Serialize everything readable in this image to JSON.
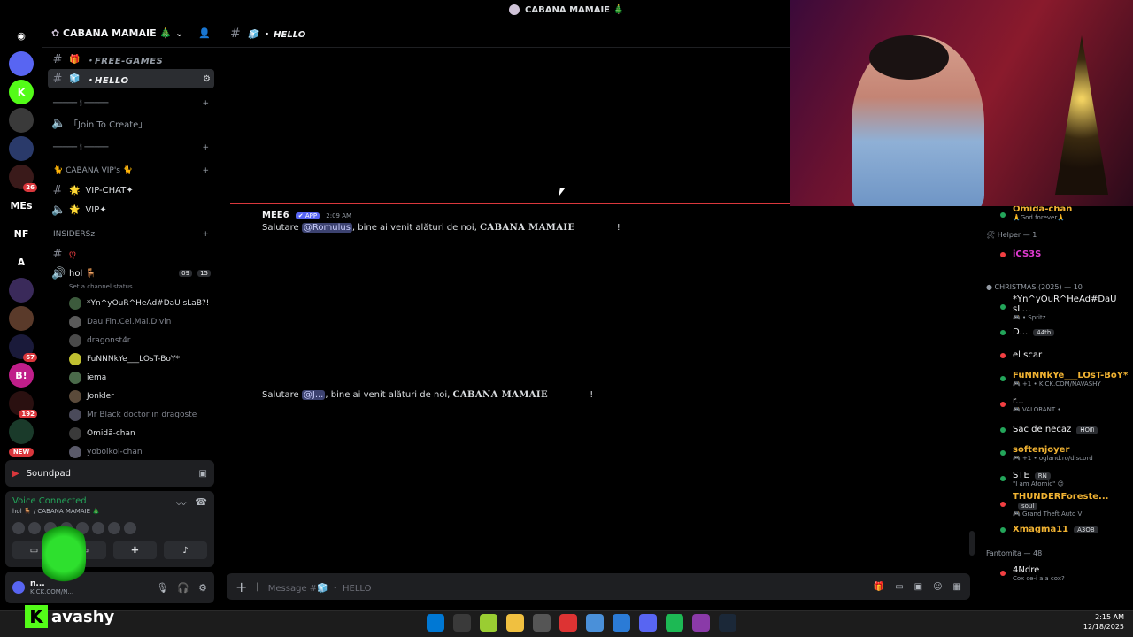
{
  "window": {
    "title": "CABANA MAMAIE 🎄"
  },
  "rail": {
    "servers": [
      {
        "label": "",
        "badge": "",
        "color": "#5865f2"
      },
      {
        "label": "K",
        "badge": "",
        "color": "#53fc18"
      },
      {
        "label": "",
        "badge": "",
        "color": "#3a3a3a"
      },
      {
        "label": "",
        "badge": "",
        "color": "#2a3a6a"
      },
      {
        "label": "",
        "badge": "26",
        "color": "#3a1a1a"
      },
      {
        "label": "MEs",
        "badge": "",
        "color": "#000000"
      },
      {
        "label": "NF",
        "badge": "",
        "color": "#000000"
      },
      {
        "label": "A",
        "badge": "",
        "color": "#000000"
      },
      {
        "label": "",
        "badge": "",
        "color": "#3a2a5a"
      },
      {
        "label": "",
        "badge": "",
        "color": "#5a3a2a"
      },
      {
        "label": "",
        "badge": "67",
        "color": "#1a1a3a"
      },
      {
        "label": "B!",
        "badge": "",
        "color": "#c01e8a"
      },
      {
        "label": "",
        "badge": "192",
        "color": "#2a1010"
      },
      {
        "label": "",
        "badge": "",
        "color": "#1a3a2a"
      }
    ],
    "new_label": "NEW"
  },
  "sidebar": {
    "server_name": "CABANA MAMAIE 🎄",
    "channels": [
      {
        "type": "text",
        "prefix": "🎁",
        "name": "・FREE-GAMES",
        "selected": false,
        "italic": true
      },
      {
        "type": "text",
        "prefix": "🧊",
        "name": "・HELLO",
        "selected": true,
        "italic": true
      }
    ],
    "divider1": "───── 🕯 ─────",
    "join_channel": "「Join To Create」",
    "divider2": "───── 🕯 ─────",
    "vip_category": "🐈 CABANA VIP's 🐈",
    "vip_channels": [
      {
        "type": "text",
        "prefix": "🌟",
        "name": "VIP-CHAT✦"
      },
      {
        "type": "voice",
        "prefix": "🌟",
        "name": "VIP✦"
      }
    ],
    "insiders_category": "INSIDERSz",
    "insiders_text_channel": "ღ",
    "voice_channel": {
      "name": "hol 🪑",
      "status_hint": "Set a channel status",
      "count_a": "09",
      "count_b": "15"
    },
    "voice_users": [
      {
        "name": "*Yn^yOuR^HeAd#DaU sLaB?!",
        "dim": false
      },
      {
        "name": "Dau.Fin.Cel.Mai.Divin",
        "dim": true
      },
      {
        "name": "dragonst4r",
        "dim": true
      },
      {
        "name": "FuNNNkYe___LOsT-BoY*",
        "dim": false
      },
      {
        "name": "iema",
        "dim": false
      },
      {
        "name": "Jonkler",
        "dim": false
      },
      {
        "name": "Mr Black doctor in dragoste",
        "dim": true
      },
      {
        "name": "Omidă-chan",
        "dim": false
      },
      {
        "name": "yoboikoi-chan",
        "dim": true
      }
    ]
  },
  "soundpad": {
    "label": "Soundpad"
  },
  "voice_panel": {
    "status": "Voice Connected",
    "location": "hol 🪑 / CABANA MAMAIE 🎄"
  },
  "userbar": {
    "name": "n...",
    "status": "KICK.COM/N..."
  },
  "chat": {
    "channel_name": "🧊 ・ HELLO",
    "messages": [
      {
        "author": "MEE6",
        "app_tag": "APP",
        "time": "2:09 AM",
        "text_before": "Salutare ",
        "mention": "@Romulus",
        "text_after": ", bine ai venit alături de noi, ",
        "bold": "CABANA MAMAIE",
        "end": "!"
      },
      {
        "author": "",
        "app_tag": "",
        "time": "",
        "text_before": "Salutare ",
        "mention": "@J...",
        "text_after": ", bine ai venit alături de noi, ",
        "bold": "CABANA MAMAIE",
        "end": "!"
      }
    ],
    "input_placeholder": "Message #🧊 ・ HELLO"
  },
  "members": {
    "top_member": {
      "name": "Omidă-chan",
      "status": "🙏God forever🙏"
    },
    "groups": [
      {
        "label": "🛠 Helper — 1",
        "members": [
          {
            "name": "iCS3S",
            "status": "",
            "tag": "",
            "color": "p",
            "dot": "r"
          }
        ]
      },
      {
        "label": "● CHRISTMAS (2025) — 10",
        "members": [
          {
            "name": "*Yn^yOuR^HeAd#DaU sL...",
            "status": "🎮 • Spritz",
            "tag": "",
            "color": "w",
            "dot": "g"
          },
          {
            "name": "D...",
            "status": "",
            "tag": "44th",
            "color": "w",
            "dot": "g"
          },
          {
            "name": "el scar",
            "status": "",
            "tag": "",
            "color": "w",
            "dot": "r"
          },
          {
            "name": "FuNNNkYe___LOsT-BoY*",
            "status": "🎮 +1 • KICK.COM/NAVASHY",
            "tag": "",
            "color": "y",
            "dot": "g"
          },
          {
            "name": "r...",
            "status": "🎮 VALORANT •",
            "tag": "",
            "color": "w",
            "dot": "r"
          },
          {
            "name": "Sac de necaz",
            "status": "",
            "tag": "ᕼOᗰ",
            "color": "w",
            "dot": "g"
          },
          {
            "name": "softenjoyer",
            "status": "🎮 +1 • ogland.ro/discord",
            "tag": "",
            "color": "y",
            "dot": "g"
          },
          {
            "name": "STE",
            "status": "\"I am Atomic\" 😍",
            "tag": "RN",
            "color": "w",
            "dot": "g"
          },
          {
            "name": "THUNDERForeste...",
            "status": "🎮 Grand Theft Auto V",
            "tag": "soul",
            "color": "y",
            "dot": "r"
          },
          {
            "name": "Xmagma11",
            "status": "",
            "tag": "A3OB",
            "color": "y",
            "dot": "g"
          }
        ]
      },
      {
        "label": "Fantomita — 48",
        "members": [
          {
            "name": "4Ndre",
            "status": "Cox ce-i ala cox?",
            "tag": "",
            "color": "w",
            "dot": "r"
          }
        ]
      }
    ]
  },
  "stream_overlay": {
    "brand_letter": "K",
    "brand_name": "avashy"
  },
  "tray": {
    "time": "2:15 AM",
    "date": "12/18/2025"
  }
}
